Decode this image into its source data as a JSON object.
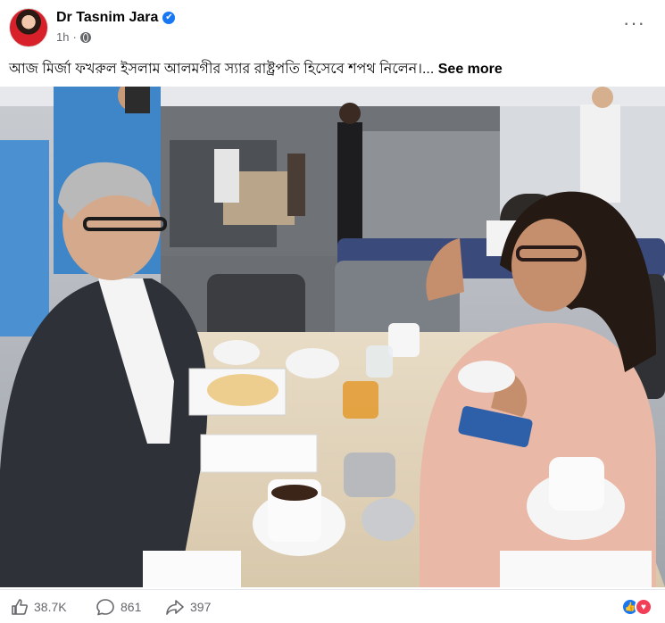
{
  "post": {
    "author": "Dr Tasnim Jara",
    "time": "1h",
    "separator": "·",
    "caption": "আজ মির্জা ফখরুল ইসলাম আলমগীর স্যার রাষ্ট্রপতি হিসেবে শপথ নিলেন।...",
    "see_more": "See more",
    "more_options": "···",
    "verified_glyph": "✔"
  },
  "stats": {
    "likes": "38.7K",
    "comments": "861",
    "shares": "397"
  },
  "reactions": [
    "like-icon",
    "love-icon"
  ],
  "colors": {
    "brand": "#1877f2",
    "love": "#f33e58",
    "secondary_text": "#65676b"
  }
}
